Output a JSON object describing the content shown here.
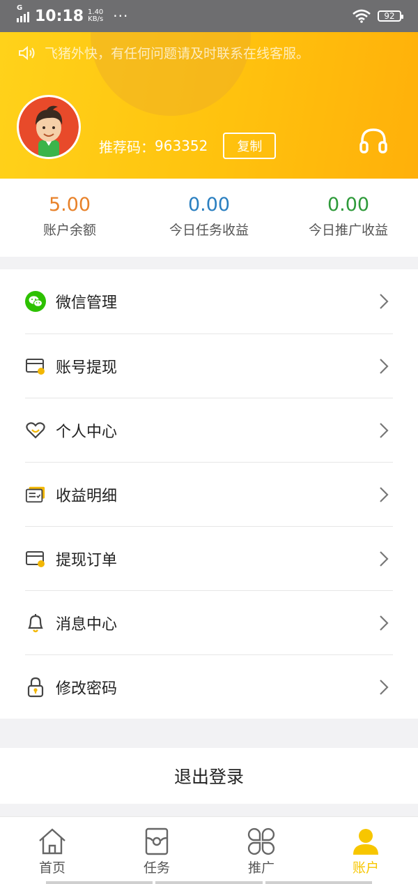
{
  "status_bar": {
    "network": "G",
    "time": "10:18",
    "speed_value": "1.40",
    "speed_unit": "KB/s",
    "dots": "···",
    "battery": "92"
  },
  "header": {
    "notice": "飞猪外快，有任何问题请及时联系在线客服。",
    "referral_label": "推荐码：",
    "referral_code": "963352",
    "copy_label": "复制"
  },
  "stats": [
    {
      "value": "5.00",
      "label": "账户余额",
      "color": "#e8822a"
    },
    {
      "value": "0.00",
      "label": "今日任务收益",
      "color": "#2a7fc0"
    },
    {
      "value": "0.00",
      "label": "今日推广收益",
      "color": "#2e9a3a"
    }
  ],
  "menu": [
    {
      "label": "微信管理",
      "icon": "wechat-icon"
    },
    {
      "label": "账号提现",
      "icon": "card-coin-icon"
    },
    {
      "label": "个人中心",
      "icon": "heart-icon"
    },
    {
      "label": "收益明细",
      "icon": "ledger-icon"
    },
    {
      "label": "提现订单",
      "icon": "card-coin-icon"
    },
    {
      "label": "消息中心",
      "icon": "bell-icon"
    },
    {
      "label": "修改密码",
      "icon": "lock-icon"
    }
  ],
  "logout_label": "退出登录",
  "tabs": [
    {
      "label": "首页",
      "icon": "home-icon"
    },
    {
      "label": "任务",
      "icon": "task-icon"
    },
    {
      "label": "推广",
      "icon": "clover-icon"
    },
    {
      "label": "账户",
      "icon": "user-icon",
      "active": true
    }
  ],
  "colors": {
    "accent": "#f7c600",
    "header_gradient_start": "#ffd21a",
    "header_gradient_end": "#ffb00a",
    "wechat_green": "#2dc100"
  }
}
